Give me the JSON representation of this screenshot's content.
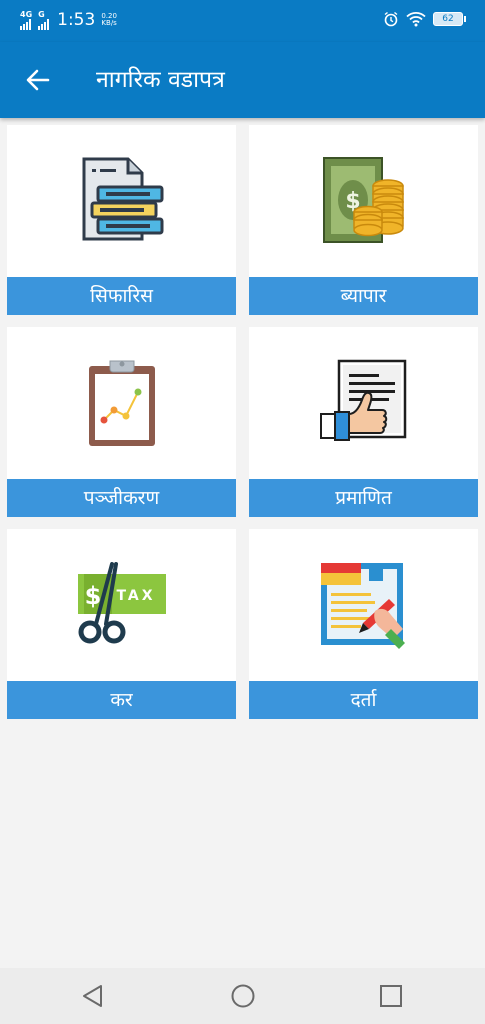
{
  "status_bar": {
    "network_1": "4G",
    "network_2": "G",
    "time": "1:53",
    "speed_value": "0.20",
    "speed_unit": "KB/s",
    "battery": "62"
  },
  "app_bar": {
    "title": "नागरिक वडापत्र",
    "back_icon": "arrow-left-icon"
  },
  "tiles": [
    {
      "label": "सिफारिस",
      "icon": "document-stack-icon"
    },
    {
      "label": "ब्यापार",
      "icon": "money-coins-icon"
    },
    {
      "label": "पञ्जीकरण",
      "icon": "clipboard-chart-icon"
    },
    {
      "label": "प्रमाणित",
      "icon": "thumbs-up-document-icon"
    },
    {
      "label": "कर",
      "icon": "tax-scissors-icon"
    },
    {
      "label": "दर्ता",
      "icon": "registration-form-icon"
    }
  ],
  "nav_bar": {
    "back": "triangle-back-icon",
    "home": "circle-home-icon",
    "recents": "square-recents-icon"
  },
  "colors": {
    "primary": "#0a7bc4",
    "tile_label_bg": "#3b95dc",
    "background": "#f3f3f3"
  }
}
